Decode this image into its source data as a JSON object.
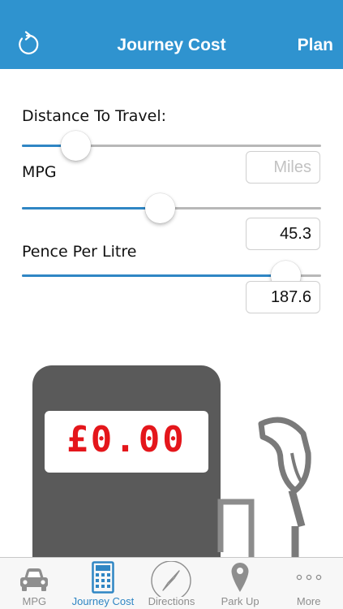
{
  "header": {
    "title": "Journey Cost",
    "right_button": "Plan",
    "left_icon": "refresh-icon"
  },
  "form": {
    "distance": {
      "label": "Distance To Travel:",
      "slider_level": 0.18,
      "input_value": "",
      "input_placeholder": "Miles"
    },
    "mpg": {
      "label": "MPG",
      "slider_level": 0.46,
      "input_value": "45.3"
    },
    "ppl": {
      "label": "Pence Per Litre",
      "slider_level": 0.88,
      "input_value": "187.6"
    }
  },
  "pump": {
    "price_display": "£0.00"
  },
  "tabs": [
    {
      "label": "MPG",
      "icon": "car-icon",
      "active": false
    },
    {
      "label": "Journey Cost",
      "icon": "calculator-icon",
      "active": true
    },
    {
      "label": "Directions",
      "icon": "compass-icon",
      "active": false
    },
    {
      "label": "Park Up",
      "icon": "map-pin-icon",
      "active": false
    },
    {
      "label": "More",
      "icon": "more-dots-icon",
      "active": false
    }
  ],
  "colors": {
    "accent": "#2f93cf",
    "price_red": "#e4161b",
    "pump_gray": "#5a5a5a",
    "tab_inactive": "#8e8e8e"
  }
}
